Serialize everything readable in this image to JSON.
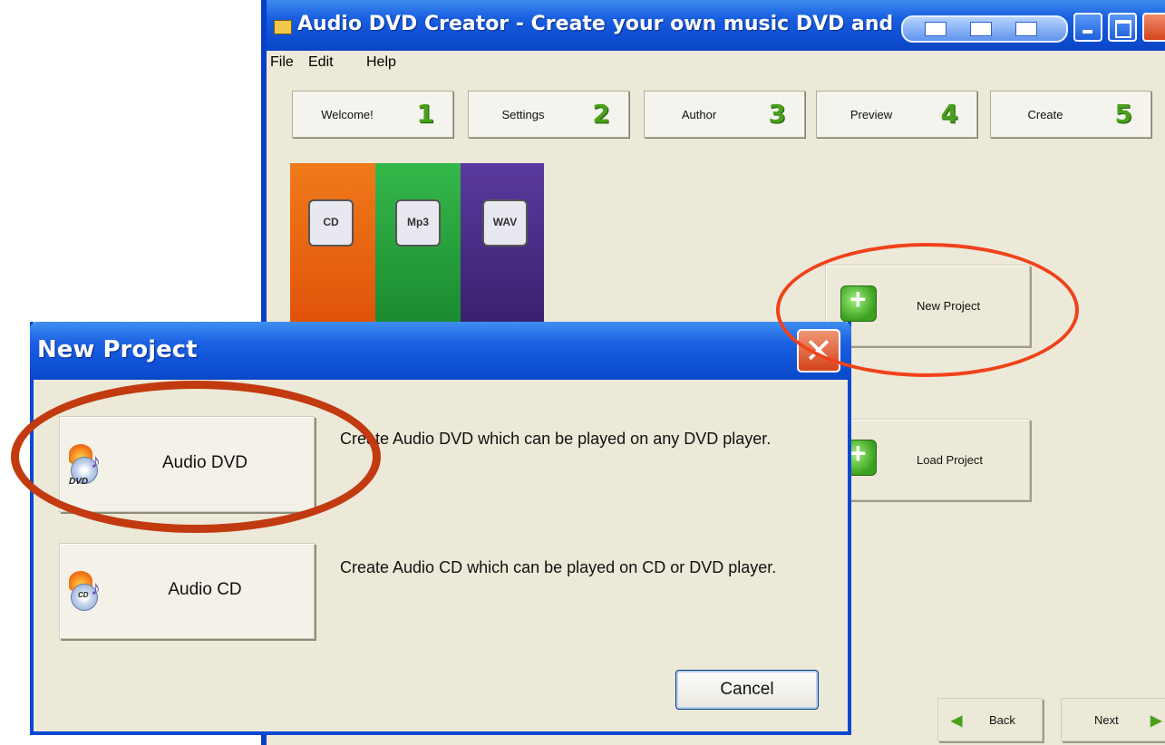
{
  "main_window": {
    "title": "Audio DVD Creator - Create your own music DVD and",
    "menu": [
      "File",
      "Edit",
      "Help"
    ],
    "steps": [
      {
        "label": "Welcome!",
        "num": "1"
      },
      {
        "label": "Settings",
        "num": "2"
      },
      {
        "label": "Author",
        "num": "3"
      },
      {
        "label": "Preview",
        "num": "4"
      },
      {
        "label": "Create",
        "num": "5"
      }
    ],
    "banner_icons": [
      "CD",
      "Mp3",
      "WAV"
    ],
    "new_project_label": "New Project",
    "load_project_label": "Load Project",
    "back_label": "Back",
    "next_label": "Next"
  },
  "dialog": {
    "title": "New Project",
    "close_glyph": "✕",
    "options": [
      {
        "label": "Audio DVD",
        "icon_tag": "DVD",
        "description": "Create Audio DVD which can be played on any DVD player."
      },
      {
        "label": "Audio CD",
        "icon_tag": "CD",
        "description": "Create Audio CD which can be played on CD or DVD player."
      }
    ],
    "cancel_label": "Cancel"
  },
  "colors": {
    "xp_blue": "#0a48d2",
    "step_green": "#4aa01c",
    "highlight_orange": "#f0421a",
    "highlight_brown": "#c23a10"
  }
}
